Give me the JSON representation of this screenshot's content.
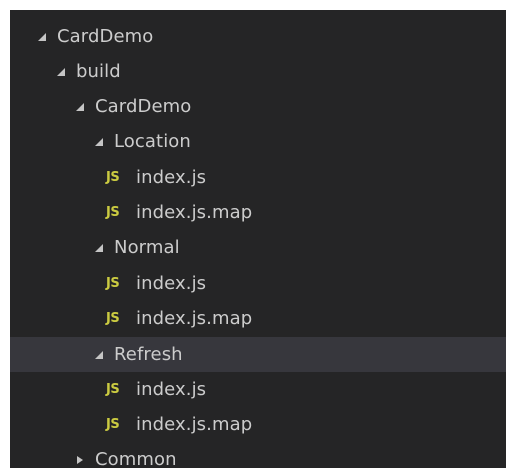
{
  "explorer": {
    "items": [
      {
        "label": "CardDemo",
        "kind": "folder",
        "expanded": true,
        "icon": "twisty-expanded-icon"
      },
      {
        "label": "build",
        "kind": "folder",
        "expanded": true,
        "icon": "twisty-expanded-icon"
      },
      {
        "label": "CardDemo",
        "kind": "folder",
        "expanded": true,
        "icon": "twisty-expanded-icon"
      },
      {
        "label": "Location",
        "kind": "folder",
        "expanded": true,
        "icon": "twisty-expanded-icon"
      },
      {
        "label": "index.js",
        "kind": "file",
        "icon_text": "JS",
        "icon": "javascript-file-icon"
      },
      {
        "label": "index.js.map",
        "kind": "file",
        "icon_text": "JS",
        "icon": "javascript-file-icon"
      },
      {
        "label": "Normal",
        "kind": "folder",
        "expanded": true,
        "icon": "twisty-expanded-icon"
      },
      {
        "label": "index.js",
        "kind": "file",
        "icon_text": "JS",
        "icon": "javascript-file-icon"
      },
      {
        "label": "index.js.map",
        "kind": "file",
        "icon_text": "JS",
        "icon": "javascript-file-icon"
      },
      {
        "label": "Refresh",
        "kind": "folder",
        "expanded": true,
        "selected": true,
        "icon": "twisty-expanded-icon"
      },
      {
        "label": "index.js",
        "kind": "file",
        "icon_text": "JS",
        "icon": "javascript-file-icon"
      },
      {
        "label": "index.js.map",
        "kind": "file",
        "icon_text": "JS",
        "icon": "javascript-file-icon"
      },
      {
        "label": "Common",
        "kind": "folder",
        "expanded": false,
        "icon": "twisty-collapsed-icon"
      }
    ]
  },
  "colors": {
    "background": "#252526",
    "selected_row": "#37373d",
    "text": "#cccccc",
    "js_icon": "#cbcb41",
    "twisty": "#c5c5c5"
  }
}
